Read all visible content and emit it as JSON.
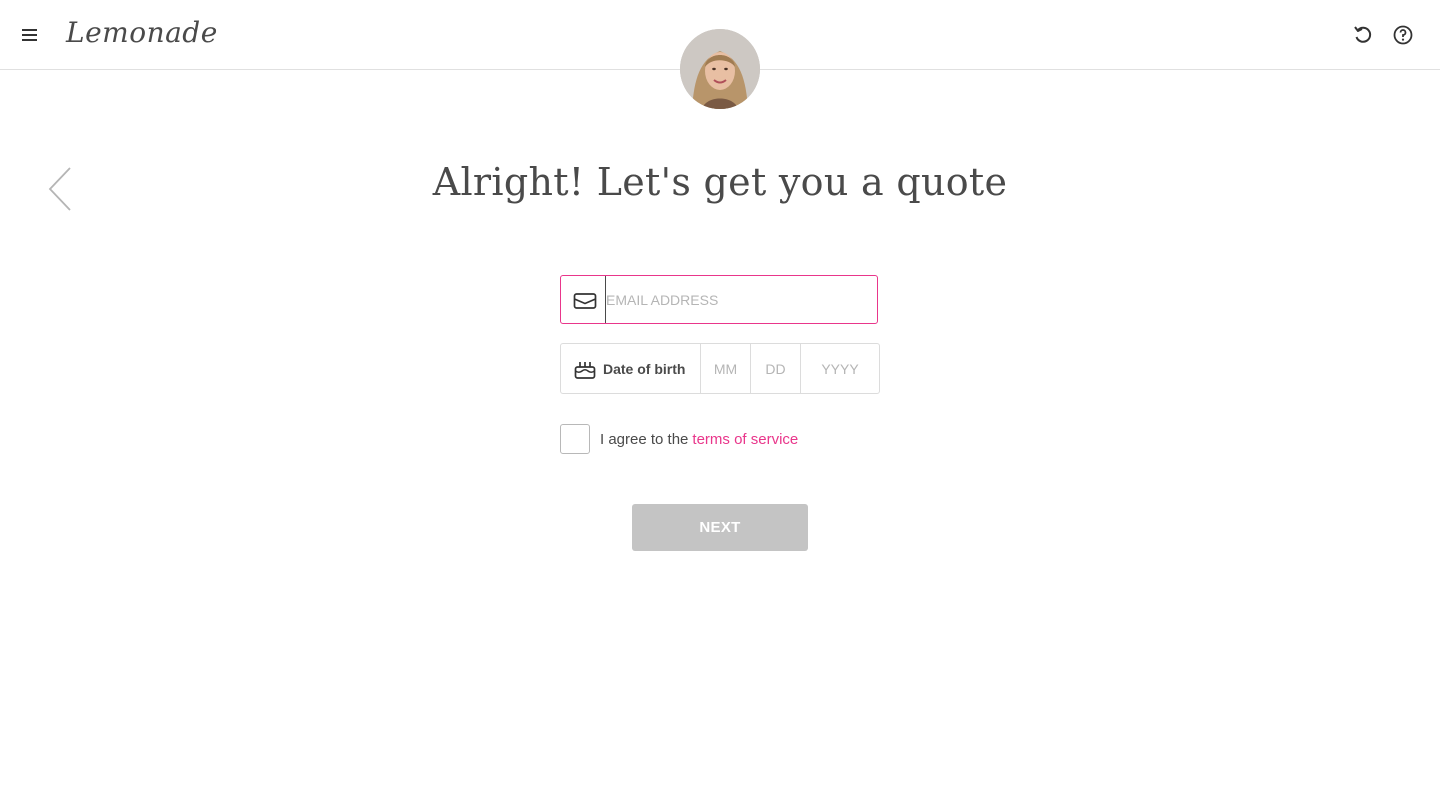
{
  "header": {
    "logo_text": "Lemonade",
    "menu_icon": "hamburger-menu-icon",
    "undo_icon": "undo-icon",
    "help_icon": "help-icon"
  },
  "main": {
    "title": "Alright! Let's get you a quote",
    "back_icon": "chevron-left-icon",
    "email": {
      "placeholder": "EMAIL ADDRESS",
      "value": "",
      "icon": "envelope-icon"
    },
    "dob": {
      "label": "Date of birth",
      "icon": "birthday-cake-icon",
      "month_placeholder": "MM",
      "day_placeholder": "DD",
      "year_placeholder": "YYYY"
    },
    "terms": {
      "prefix": "I agree to the",
      "link_text": "terms of service",
      "checked": false
    },
    "next_label": "NEXT"
  },
  "colors": {
    "accent": "#e9368b",
    "text": "#4a4a4a",
    "button_disabled": "#c4c4c4",
    "border": "#dcdcdc"
  }
}
